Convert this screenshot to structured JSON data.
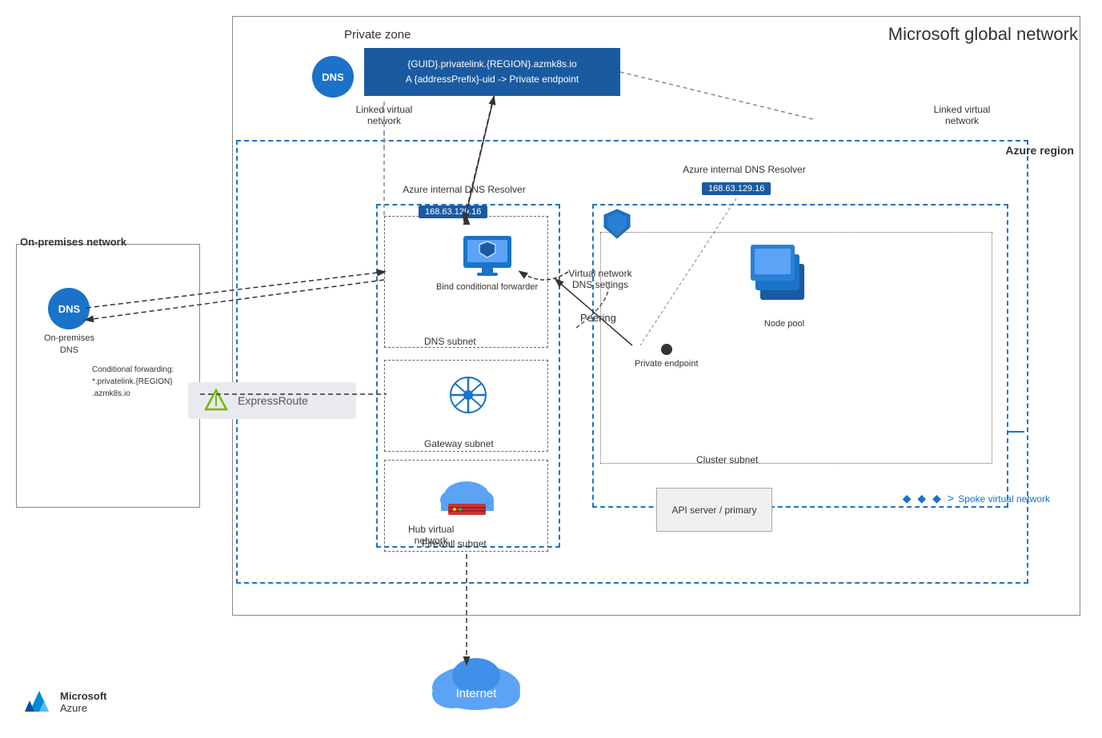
{
  "title": "Microsoft global network",
  "private_zone": {
    "label": "Private zone",
    "dns_label": "DNS",
    "box_line1": "{GUID}.privatelink.{REGION}.azmk8s.io",
    "box_line2": "A {addressPrefix}-uid -> Private endpoint"
  },
  "linked_vnet_left": "Linked virtual\nnetwork",
  "linked_vnet_right": "Linked virtual\nnetwork",
  "azure_region_label": "Azure region",
  "hub_vnet_label": "Hub virtual\nnetwork",
  "spoke_vnet_label": "Spoke virtual network",
  "dns_resolver_left": "Azure internal DNS Resolver",
  "dns_resolver_right": "Azure internal DNS Resolver",
  "ip_left": "168.63.129.16",
  "ip_right": "168.63.129.16",
  "dns_subnet_label": "DNS subnet",
  "bind_forwarder_label": "Bind\nconditional\nforwarder",
  "gateway_subnet_label": "Gateway subnet",
  "firewall_subnet_label": "Firewall subnet",
  "cluster_subnet_label": "Cluster subnet",
  "vnet_dns_settings": "Virtual network\nDNS settings",
  "peering_label": "Peering",
  "on_prem_title": "On-premises network",
  "on_prem_dns_label": "On-premises\nDNS",
  "conditional_forwarding": "Conditional forwarding:\n*.privatelink.{REGION}\n.azmk8s.io",
  "expressroute_label": "ExpressRoute",
  "private_endpoint_label": "Private\nendpoint",
  "node_pool_label": "Node pool",
  "api_server_label": "API server /\nprimary",
  "internet_label": "Internet",
  "ms_azure_line1": "Microsoft",
  "ms_azure_line2": "Azure"
}
